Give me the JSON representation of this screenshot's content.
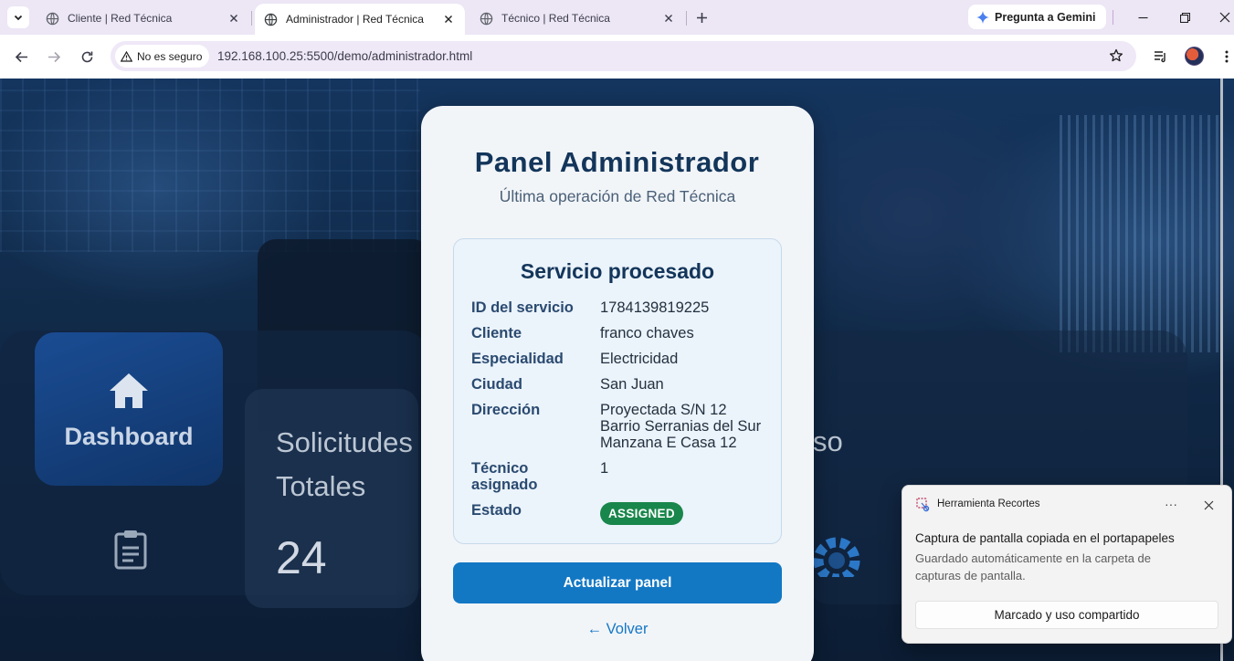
{
  "browser": {
    "tabs": [
      {
        "label": "Cliente | Red Técnica",
        "active": false
      },
      {
        "label": "Administrador | Red Técnica",
        "active": true
      },
      {
        "label": "Técnico | Red Técnica",
        "active": false
      }
    ],
    "gemini_label": "Pregunta a Gemini",
    "security_label": "No es seguro",
    "url": "192.168.100.25:5500/demo/administrador.html"
  },
  "background": {
    "dashboard_label": "Dashboard",
    "requests_label": "Solicitudes Totales",
    "requests_count": "24",
    "partial_label": "so"
  },
  "panel": {
    "title": "Panel Administrador",
    "subtitle": "Última operación de Red Técnica",
    "service_title": "Servicio procesado",
    "rows": [
      {
        "label": "ID del servicio",
        "value": "1784139819225"
      },
      {
        "label": "Cliente",
        "value": "franco chaves"
      },
      {
        "label": "Especialidad",
        "value": "Electricidad"
      },
      {
        "label": "Ciudad",
        "value": "San Juan"
      },
      {
        "label": "Dirección",
        "value_lines": [
          "Proyectada S/N 12",
          "Barrio Serranias del Sur",
          "Manzana E Casa 12"
        ]
      },
      {
        "label_lines": [
          "Técnico",
          "asignado"
        ],
        "value": "1"
      },
      {
        "label": "Estado",
        "value": "ASSIGNED"
      }
    ],
    "status_color": "#19864b",
    "refresh_button": "Actualizar panel",
    "back_link": "← Volver",
    "accent": "#1378c4"
  },
  "notification": {
    "app_name": "Herramienta Recortes",
    "more": "···",
    "heading": "Captura de pantalla copiada en el portapapeles",
    "body": "Guardado automáticamente en la carpeta de capturas de pantalla.",
    "action": "Marcado y uso compartido"
  }
}
